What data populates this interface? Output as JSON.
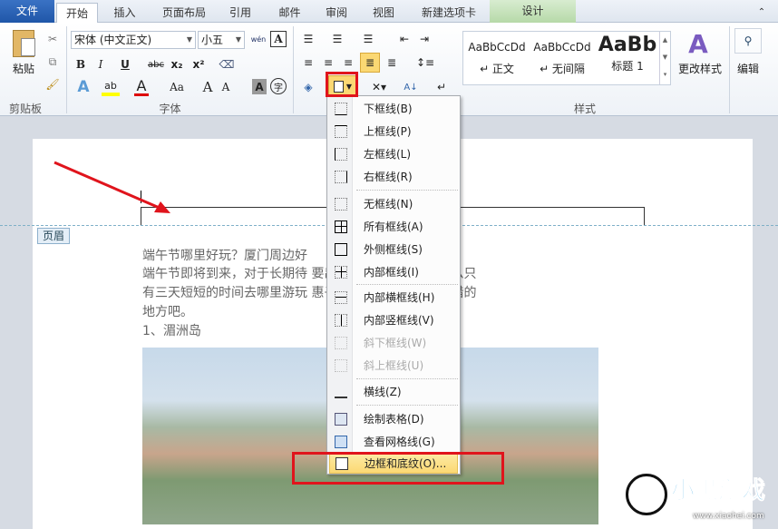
{
  "tabs": [
    "文件",
    "开始",
    "插入",
    "页面布局",
    "引用",
    "邮件",
    "审阅",
    "视图",
    "新建选项卡",
    "设计"
  ],
  "clipboard": {
    "paste": "粘贴",
    "label": "剪贴板"
  },
  "font": {
    "name": "宋体 (中文正文)",
    "size": "小五",
    "label": "字体",
    "bold": "B",
    "italic": "I",
    "underline": "U",
    "strike": "abc",
    "sub": "x₂",
    "sup": "x²",
    "grow": "A",
    "shrink": "A",
    "case": "Aa",
    "color": "A",
    "char_border": "A",
    "enclose": "字",
    "phonetic": "wén"
  },
  "styles": {
    "label": "样式",
    "items": [
      {
        "sample": "AaBbCcDd",
        "name": "↵ 正文"
      },
      {
        "sample": "AaBbCcDd",
        "name": "↵ 无间隔"
      },
      {
        "sample": "AaBb",
        "name": "标题 1"
      }
    ],
    "change": "更改样式"
  },
  "editing": {
    "label": "编辑"
  },
  "header_tag": "页眉",
  "document": {
    "lines": [
      "端午节哪里好玩？厦门周边好",
      "端午节即将到来，对于长期待                        要出厦门到周边走走，那么只",
      "有三天短短的时间去哪里游玩                        惠子就位大家介绍几个不错的",
      "地方吧。",
      "1、湄洲岛"
    ]
  },
  "menu": [
    {
      "label": "下框线(B)"
    },
    {
      "label": "上框线(P)"
    },
    {
      "label": "左框线(L)"
    },
    {
      "label": "右框线(R)"
    },
    {
      "label": "无框线(N)"
    },
    {
      "label": "所有框线(A)"
    },
    {
      "label": "外侧框线(S)"
    },
    {
      "label": "内部框线(I)"
    },
    {
      "label": "内部横框线(H)"
    },
    {
      "label": "内部竖框线(V)"
    },
    {
      "label": "斜下框线(W)"
    },
    {
      "label": "斜上框线(U)"
    },
    {
      "label": "横线(Z)"
    },
    {
      "label": "绘制表格(D)"
    },
    {
      "label": "查看网格线(G)"
    },
    {
      "label": "边框和底纹(O)..."
    }
  ],
  "watermark": {
    "brand": "小黑游戏",
    "url": "www.xiaohei.com"
  },
  "colors": {
    "file_tab": "#2a62b6",
    "highlight": "#fbd873",
    "red": "#e0141c"
  }
}
